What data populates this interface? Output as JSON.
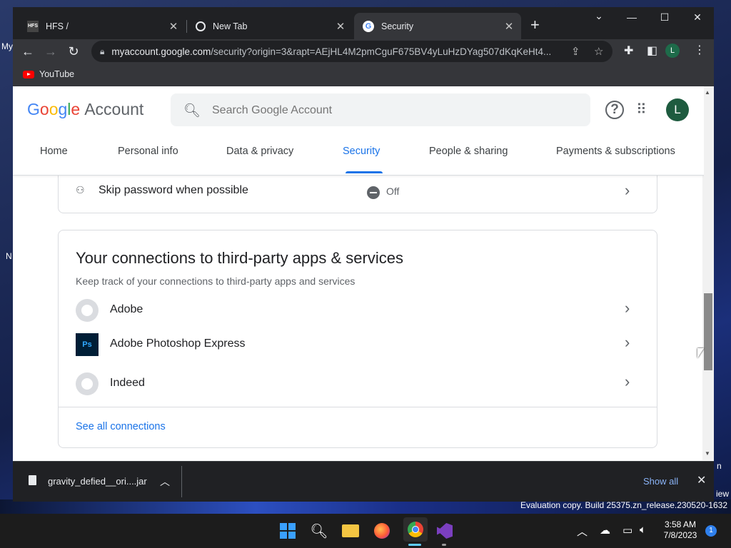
{
  "browser": {
    "tabs": [
      {
        "title": "HFS /",
        "icon": "hfs-icon"
      },
      {
        "title": "New Tab",
        "icon": "chrome-icon"
      },
      {
        "title": "Security",
        "icon": "google-icon",
        "active": true
      }
    ],
    "url_host": "myaccount.google.com",
    "url_path": "/security?origin=3&rapt=AEjHL4M2pmCguF675BV4yLuHzDYag507dKqKeHt4...",
    "profile_initial": "L",
    "bookmarks": [
      {
        "label": "YouTube",
        "icon": "youtube-icon"
      }
    ]
  },
  "header": {
    "logo_google": "Google",
    "logo_account": "Account",
    "search_placeholder": "Search Google Account",
    "avatar_initial": "L"
  },
  "nav": {
    "tabs": [
      "Home",
      "Personal info",
      "Data & privacy",
      "Security",
      "People & sharing",
      "Payments & subscriptions"
    ],
    "active": "Security"
  },
  "skip_password": {
    "label": "Skip password when possible",
    "status": "Off"
  },
  "connections": {
    "title": "Your connections to third-party apps & services",
    "subtitle": "Keep track of your connections to third-party apps and services",
    "apps": [
      {
        "name": "Adobe",
        "icon": "generic-app-icon"
      },
      {
        "name": "Adobe Photoshop Express",
        "icon": "photoshop-icon",
        "icon_text": "Ps"
      },
      {
        "name": "Indeed",
        "icon": "generic-app-icon"
      }
    ],
    "see_all": "See all connections"
  },
  "download_bar": {
    "file_name": "gravity_defied__ori....jar",
    "show_all": "Show all"
  },
  "desktop": {
    "label_my": "My",
    "label_n": "N",
    "label_n2": "n",
    "label_view": "iew",
    "eval_text": "Evaluation copy. Build 25375.zn_release.230520-1632"
  },
  "taskbar": {
    "time": "3:58 AM",
    "date": "7/8/2023",
    "notifications": "1"
  },
  "colors": {
    "accent": "#1a73e8",
    "chrome_dark": "#202124",
    "chrome_toolbar": "#35363a",
    "avatar": "#1e5b3f"
  }
}
